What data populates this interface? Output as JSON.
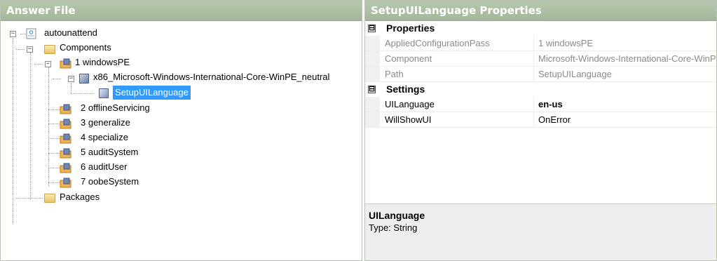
{
  "answer_file": {
    "title": "Answer File",
    "tree": {
      "root": "autounattend",
      "components": "Components",
      "pass_1": "1 windowsPE",
      "component_node": "x86_Microsoft-Windows-International-Core-WinPE_neutral",
      "setting_node": "SetupUILanguage",
      "pass_2": "2 offlineServicing",
      "pass_3": "3 generalize",
      "pass_4": "4 specialize",
      "pass_5": "5 auditSystem",
      "pass_6": "6 auditUser",
      "pass_7": "7 oobeSystem",
      "packages": "Packages"
    }
  },
  "properties": {
    "title": "SetupUILanguage Properties",
    "cat_properties": "Properties",
    "cat_settings": "Settings",
    "rows": [
      {
        "key": "AppliedConfigurationPass",
        "value": "1 windowsPE"
      },
      {
        "key": "Component",
        "value": "Microsoft-Windows-International-Core-WinPE"
      },
      {
        "key": "Path",
        "value": "SetupUILanguage"
      }
    ],
    "settings": [
      {
        "key": "UILanguage",
        "value": "en-us"
      },
      {
        "key": "WillShowUI",
        "value": "OnError"
      }
    ],
    "description": {
      "title": "UILanguage",
      "type": "Type: String"
    },
    "toggle_glyph": "⊟"
  },
  "colors": {
    "header_bg": "#a9bb9f",
    "selection": "#3399ff"
  }
}
